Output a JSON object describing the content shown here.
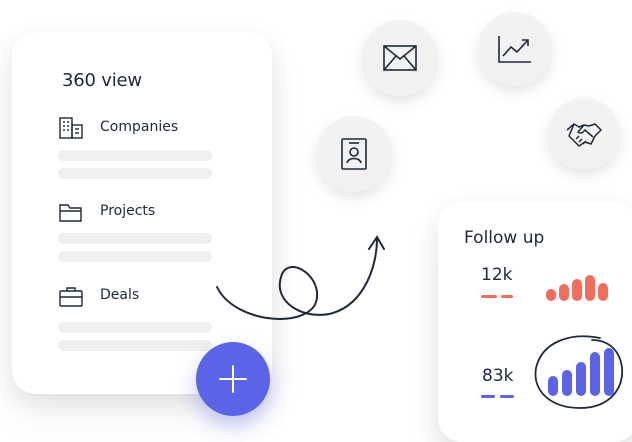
{
  "view_card": {
    "title": "360 view",
    "items": [
      {
        "label": "Companies",
        "icon": "building-icon"
      },
      {
        "label": "Projects",
        "icon": "folder-icon"
      },
      {
        "label": "Deals",
        "icon": "briefcase-icon"
      }
    ]
  },
  "actions": {
    "icons": [
      "mail-icon",
      "line-chart-icon",
      "contact-card-icon",
      "handshake-icon"
    ],
    "add_icon": "plus-icon",
    "add_color": "#5b63e6"
  },
  "follow_up": {
    "title": "Follow up",
    "metrics": [
      {
        "value": "12k",
        "color": "#f26d5b",
        "bars": [
          1,
          2,
          3,
          3.4,
          2.6
        ]
      },
      {
        "value": "83k",
        "color": "#5b63e6",
        "bars": [
          1,
          1.6,
          2.4,
          3.6,
          4.6
        ]
      }
    ]
  }
}
